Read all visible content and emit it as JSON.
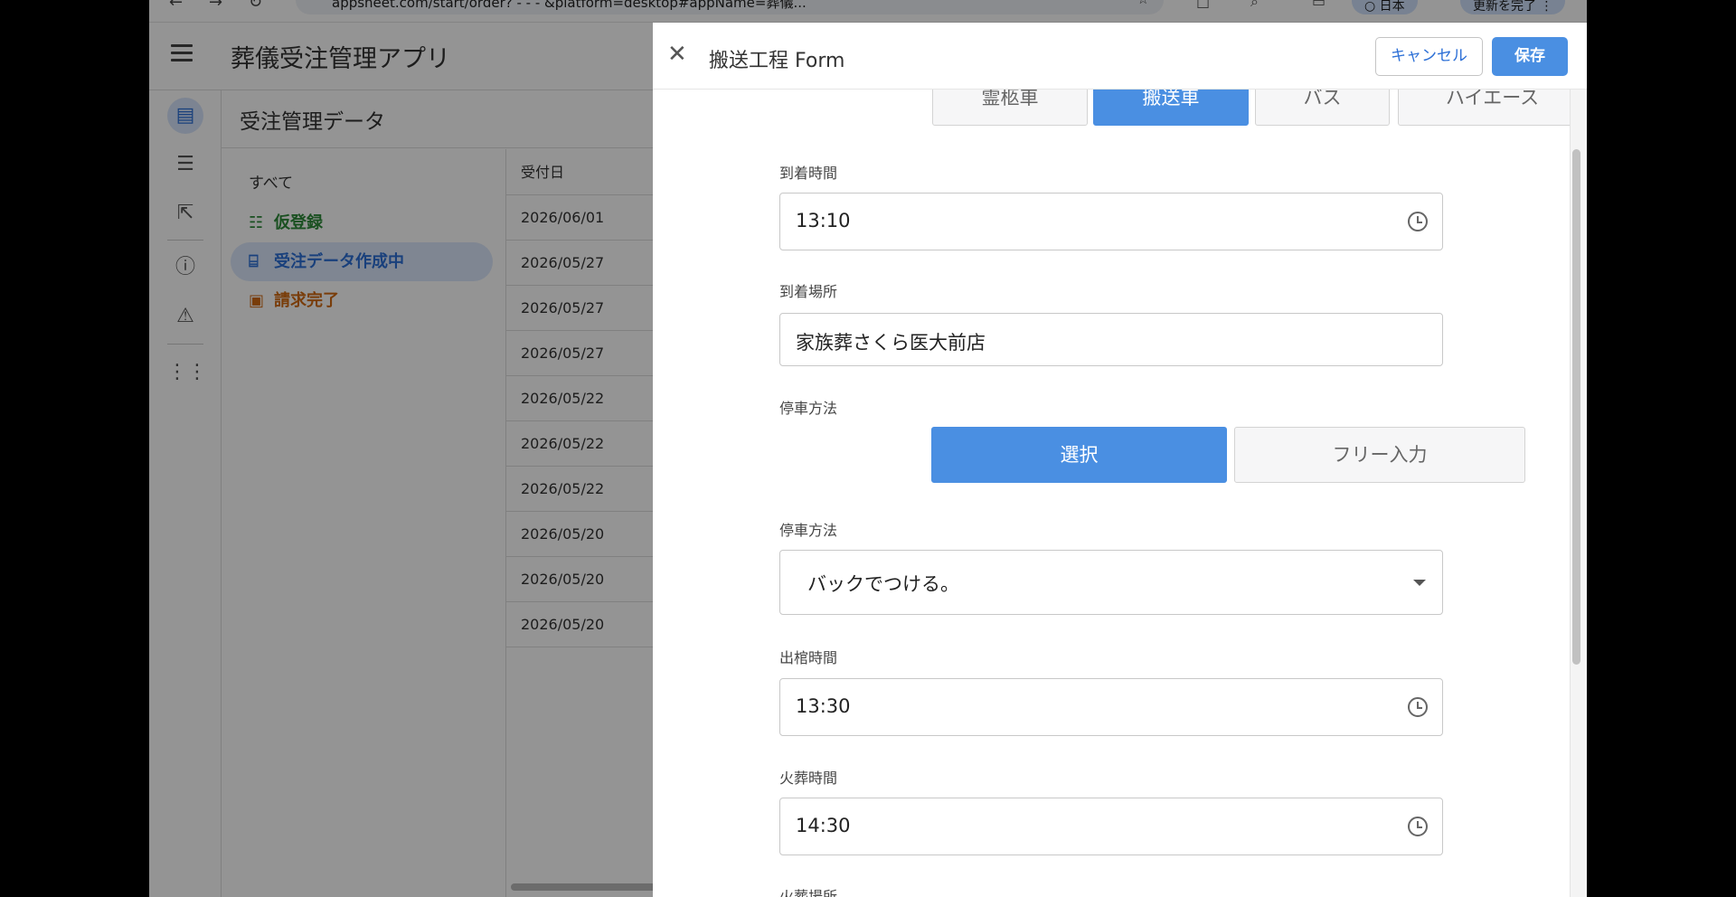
{
  "browser": {
    "url": "appsheet.com/start/order?  -  -     -    &platform=desktop#appName=葬儀...",
    "btn_a": "○ 日本",
    "btn_b": "更新を完了 ⋮"
  },
  "app": {
    "title": "葬儀受注管理アプリ",
    "panel_title": "受注管理データ",
    "categories": [
      {
        "label": "すべて"
      },
      {
        "label": "仮登録",
        "color": "#2e8b3a"
      },
      {
        "label": "受注データ作成中",
        "color": "#2c6fd6"
      },
      {
        "label": "請求完了",
        "color": "#d06a12"
      }
    ],
    "table": {
      "header": "受付日",
      "rows": [
        "2026/06/01",
        "2026/05/27",
        "2026/05/27",
        "2026/05/27",
        "2026/05/22",
        "2026/05/22",
        "2026/05/22",
        "2026/05/20",
        "2026/05/20",
        "2026/05/20"
      ]
    }
  },
  "form": {
    "title": "搬送工程 Form",
    "cancel": "キャンセル",
    "save": "保存",
    "vehicle_options": [
      "霊柩車",
      "搬送車",
      "バス",
      "ハイエース"
    ],
    "vehicle_selected": "搬送車",
    "arrival_time": {
      "label": "到着時間",
      "value": "13:10"
    },
    "arrival_place": {
      "label": "到着場所",
      "value": "家族葬さくら医大前店"
    },
    "parking_mode": {
      "label": "停車方法",
      "options": [
        "選択",
        "フリー入力"
      ],
      "selected": "選択"
    },
    "parking_method": {
      "label": "停車方法",
      "value": "バックでつける。"
    },
    "departure_time": {
      "label": "出棺時間",
      "value": "13:30"
    },
    "cremation_time": {
      "label": "火葬時間",
      "value": "14:30"
    },
    "cremation_place": {
      "label": "火葬場所"
    }
  },
  "colors": {
    "accent": "#4a8fe2",
    "green": "#2e8b3a",
    "orange": "#d06a12"
  }
}
